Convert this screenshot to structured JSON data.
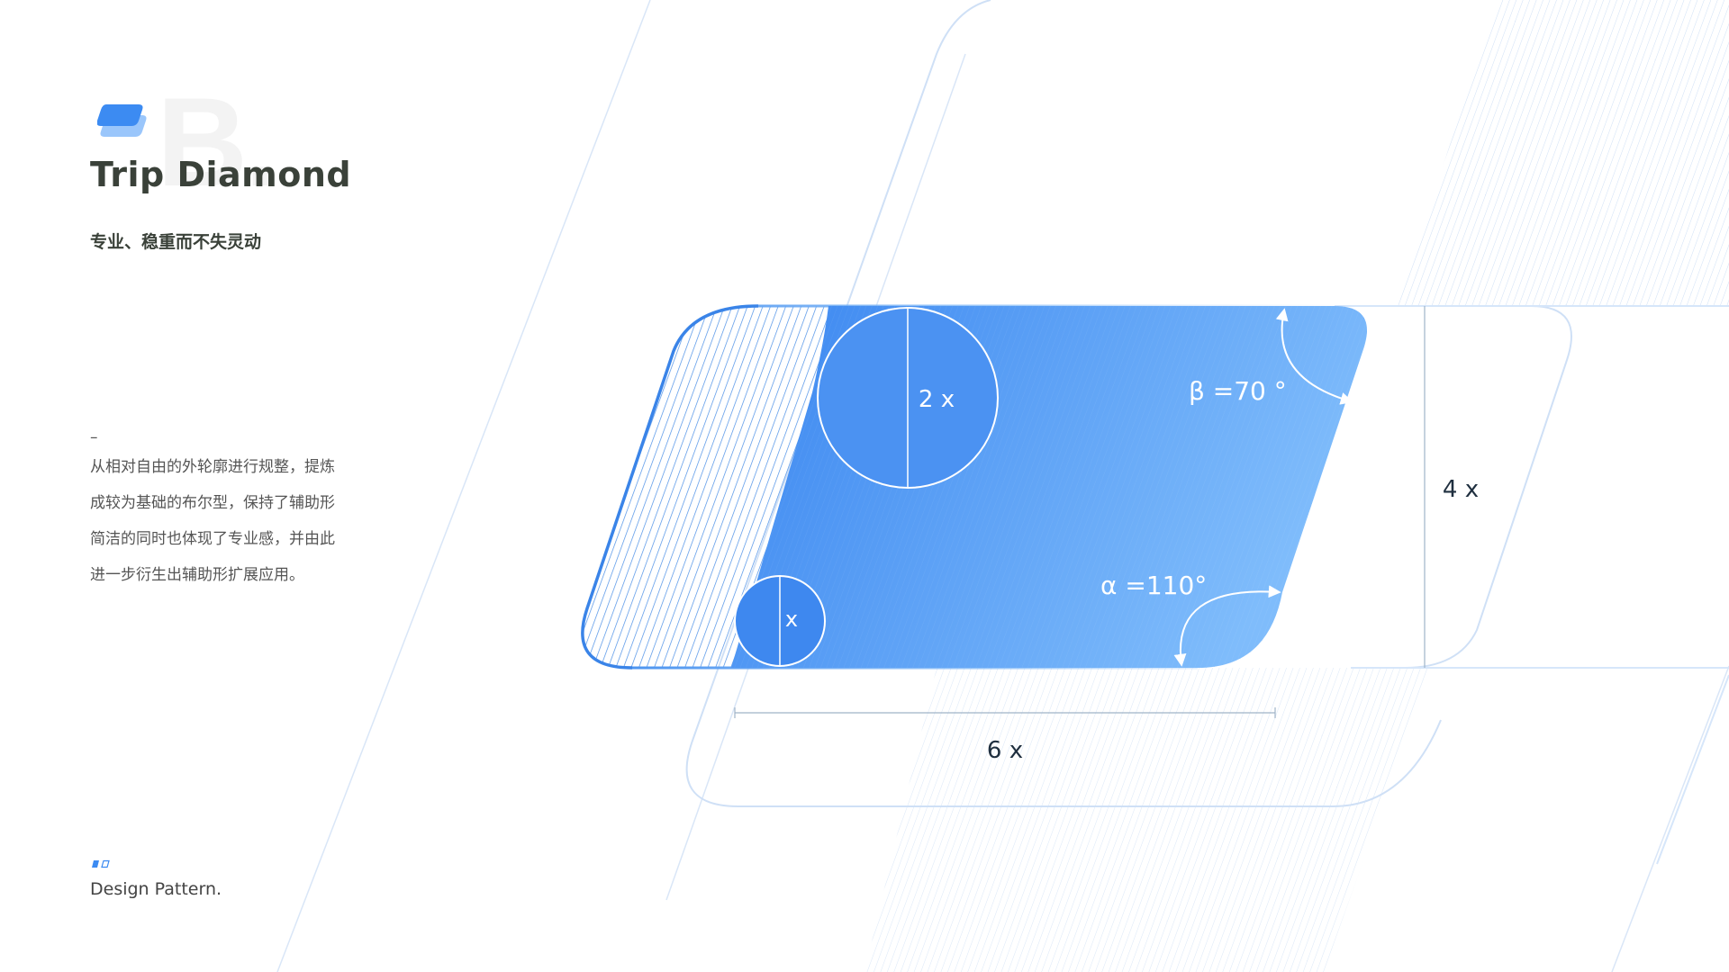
{
  "header": {
    "watermark": "B.",
    "title": "Trip Diamond",
    "subtitle": "专业、稳重而不失灵动"
  },
  "description": {
    "dash": "–",
    "lines": [
      "从相对自由的外轮廓进行规整，提炼",
      "成较为基础的布尔型，保持了辅助形",
      "简洁的同时也体现了专业感，并由此",
      "进一步衍生出辅助形扩展应用。"
    ]
  },
  "footer": {
    "label": "Design Pattern."
  },
  "diagram": {
    "circle_large_label": "2 x",
    "circle_small_label": "x",
    "beta_label": "β =70 °",
    "alpha_label": "α =110°",
    "height_label": "4 x",
    "width_label": "6 x"
  },
  "colors": {
    "accent": "#3c8bf2",
    "accent_light": "#79b7fb",
    "outline": "#3a84e8",
    "faint_line": "#cfe0f6",
    "text_dark": "#3a4139",
    "text_body": "#555555"
  }
}
